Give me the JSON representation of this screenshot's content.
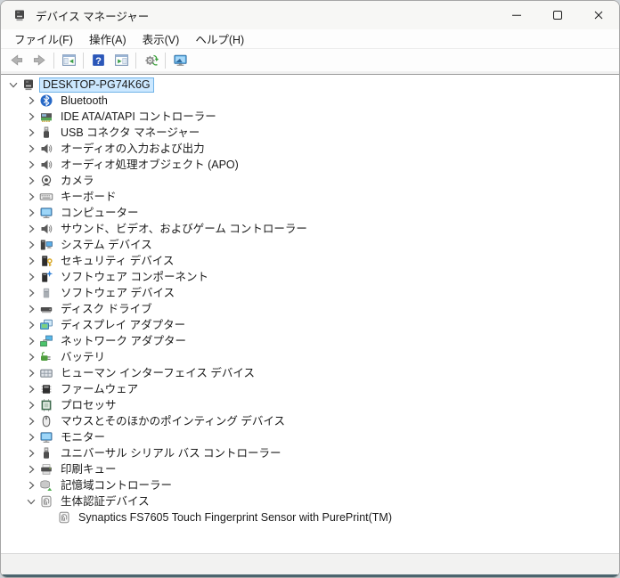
{
  "window": {
    "title": "デバイス マネージャー",
    "controls": [
      {
        "name": "minimize",
        "icon": "minimize"
      },
      {
        "name": "maximize",
        "icon": "maximize"
      },
      {
        "name": "close",
        "icon": "close"
      }
    ]
  },
  "menu": {
    "items": [
      {
        "label": "ファイル(F)"
      },
      {
        "label": "操作(A)"
      },
      {
        "label": "表示(V)"
      },
      {
        "label": "ヘルプ(H)"
      }
    ]
  },
  "toolbar": {
    "items": [
      {
        "type": "button",
        "name": "back",
        "icon": "arrow-left",
        "disabled": true
      },
      {
        "type": "button",
        "name": "forward",
        "icon": "arrow-right",
        "disabled": true
      },
      {
        "type": "separator"
      },
      {
        "type": "button",
        "name": "console-tree",
        "icon": "console-tree"
      },
      {
        "type": "separator"
      },
      {
        "type": "button",
        "name": "help",
        "icon": "help"
      },
      {
        "type": "button",
        "name": "action-pane",
        "icon": "action-pane"
      },
      {
        "type": "separator"
      },
      {
        "type": "button",
        "name": "scan-hardware",
        "icon": "scan-hardware"
      },
      {
        "type": "separator"
      },
      {
        "type": "button",
        "name": "remote-computer",
        "icon": "remote-computer"
      }
    ]
  },
  "tree": {
    "items": [
      {
        "label": "DESKTOP-PG74K6G",
        "icon": "computer",
        "level": 0,
        "state": "expanded",
        "selected": true
      },
      {
        "label": "Bluetooth",
        "icon": "bluetooth",
        "level": 1,
        "state": "collapsed"
      },
      {
        "label": "IDE ATA/ATAPI コントローラー",
        "icon": "ide-controller",
        "level": 1,
        "state": "collapsed"
      },
      {
        "label": "USB コネクタ マネージャー",
        "icon": "usb-connector",
        "level": 1,
        "state": "collapsed"
      },
      {
        "label": "オーディオの入力および出力",
        "icon": "speaker",
        "level": 1,
        "state": "collapsed"
      },
      {
        "label": "オーディオ処理オブジェクト (APO)",
        "icon": "speaker",
        "level": 1,
        "state": "collapsed"
      },
      {
        "label": "カメラ",
        "icon": "camera",
        "level": 1,
        "state": "collapsed"
      },
      {
        "label": "キーボード",
        "icon": "keyboard",
        "level": 1,
        "state": "collapsed"
      },
      {
        "label": "コンピューター",
        "icon": "monitor",
        "level": 1,
        "state": "collapsed"
      },
      {
        "label": "サウンド、ビデオ、およびゲーム コントローラー",
        "icon": "speaker",
        "level": 1,
        "state": "collapsed"
      },
      {
        "label": "システム デバイス",
        "icon": "system-devices",
        "level": 1,
        "state": "collapsed"
      },
      {
        "label": "セキュリティ デバイス",
        "icon": "security-device",
        "level": 1,
        "state": "collapsed"
      },
      {
        "label": "ソフトウェア コンポーネント",
        "icon": "software-component",
        "level": 1,
        "state": "collapsed"
      },
      {
        "label": "ソフトウェア デバイス",
        "icon": "software-device",
        "level": 1,
        "state": "collapsed"
      },
      {
        "label": "ディスク ドライブ",
        "icon": "disk-drive",
        "level": 1,
        "state": "collapsed"
      },
      {
        "label": "ディスプレイ アダプター",
        "icon": "display-adapter",
        "level": 1,
        "state": "collapsed"
      },
      {
        "label": "ネットワーク アダプター",
        "icon": "network-adapter",
        "level": 1,
        "state": "collapsed"
      },
      {
        "label": "バッテリ",
        "icon": "battery",
        "level": 1,
        "state": "collapsed"
      },
      {
        "label": "ヒューマン インターフェイス デバイス",
        "icon": "hid",
        "level": 1,
        "state": "collapsed"
      },
      {
        "label": "ファームウェア",
        "icon": "firmware",
        "level": 1,
        "state": "collapsed"
      },
      {
        "label": "プロセッサ",
        "icon": "processor",
        "level": 1,
        "state": "collapsed"
      },
      {
        "label": "マウスとそのほかのポインティング デバイス",
        "icon": "mouse",
        "level": 1,
        "state": "collapsed"
      },
      {
        "label": "モニター",
        "icon": "monitor",
        "level": 1,
        "state": "collapsed"
      },
      {
        "label": "ユニバーサル シリアル バス コントローラー",
        "icon": "usb-connector",
        "level": 1,
        "state": "collapsed"
      },
      {
        "label": "印刷キュー",
        "icon": "printer",
        "level": 1,
        "state": "collapsed"
      },
      {
        "label": "記憶域コントローラー",
        "icon": "storage-controller",
        "level": 1,
        "state": "collapsed"
      },
      {
        "label": "生体認証デバイス",
        "icon": "fingerprint",
        "level": 1,
        "state": "expanded"
      },
      {
        "label": "Synaptics FS7605 Touch Fingerprint Sensor with PurePrint(TM)",
        "icon": "fingerprint",
        "level": 2,
        "state": "none"
      }
    ]
  },
  "statusbar": {
    "text": ""
  },
  "colors": {
    "selection_bg": "#cce8ff",
    "selection_border": "#70b3e8",
    "titlebar_bg": "#f7f7f5",
    "help_button_blue": "#2a56b8",
    "window_bottom_edge": "#4c656e"
  }
}
